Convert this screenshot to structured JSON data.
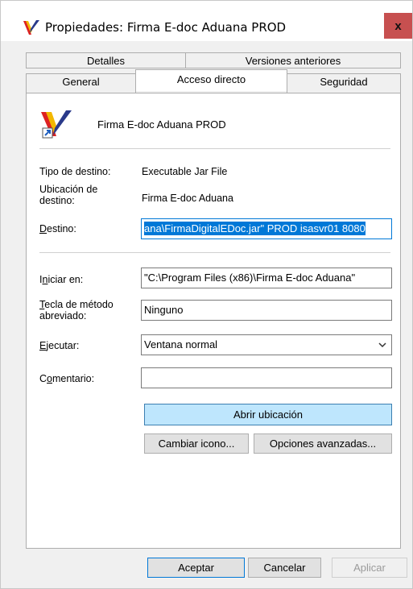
{
  "window": {
    "title": "Propiedades: Firma E-doc Aduana PROD",
    "close_glyph": "x"
  },
  "tabs": {
    "row1": [
      "Detalles",
      "Versiones anteriores"
    ],
    "row2": [
      "General",
      "Acceso directo",
      "Seguridad"
    ]
  },
  "header": {
    "name": "Firma E-doc Aduana PROD",
    "icon": "firma-app-shortcut-icon"
  },
  "fields": {
    "tipo_label": "Tipo de destino:",
    "tipo_value": "Executable Jar File",
    "ubicacion_label": "Ubicación de destino:",
    "ubicacion_value": "Firma E-doc Aduana",
    "destino_label": "Destino:",
    "destino_value": "ana\\FirmaDigitalEDoc.jar\" PROD isasvr01 8080",
    "iniciar_label": "Iniciar en:",
    "iniciar_value": "\"C:\\Program Files (x86)\\Firma E-doc Aduana\"",
    "tecla_label": "Tecla de método abreviado:",
    "tecla_value": "Ninguno",
    "ejecutar_label": "Ejecutar:",
    "ejecutar_value": "Ventana normal",
    "comentario_label": "Comentario:",
    "comentario_value": ""
  },
  "buttons": {
    "abrir_ubicacion": "Abrir ubicación",
    "cambiar_icono": "Cambiar icono...",
    "opciones_avanzadas": "Opciones avanzadas...",
    "aceptar": "Aceptar",
    "cancelar": "Cancelar",
    "aplicar": "Aplicar"
  },
  "colors": {
    "selection": "#0078d7",
    "highlight_button": "#bee6fd",
    "close_button": "#c75050"
  }
}
